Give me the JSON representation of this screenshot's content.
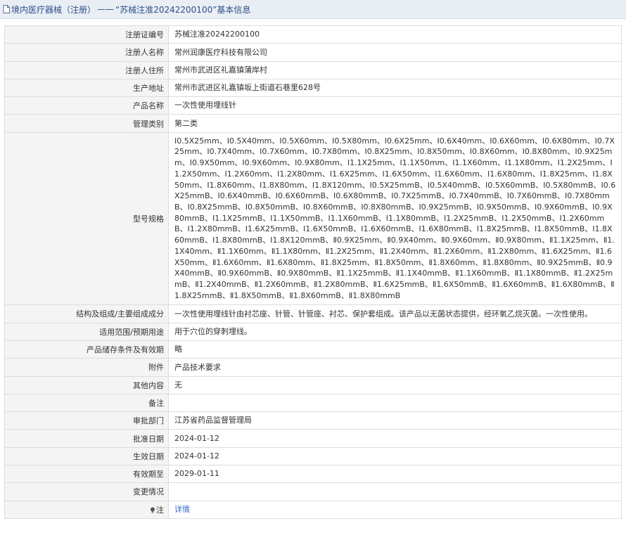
{
  "header": {
    "prefix": "境内医疗器械（注册）",
    "separator": "——",
    "title": "“苏械注准20242200100”基本信息"
  },
  "rows": [
    {
      "label": "注册证编号",
      "value": "苏械注准20242200100"
    },
    {
      "label": "注册人名称",
      "value": "常州润康医疗科技有限公司"
    },
    {
      "label": "注册人住所",
      "value": "常州市武进区礼嘉镇蒲岸村"
    },
    {
      "label": "生产地址",
      "value": "常州市武进区礼嘉镇坂上街道石巷里628号"
    },
    {
      "label": "产品名称",
      "value": "一次性使用埋线针"
    },
    {
      "label": "管理类别",
      "value": "第二类"
    },
    {
      "label": "型号规格",
      "value": "Ⅰ0.5X25mm、Ⅰ0.5X40mm、Ⅰ0.5X60mm、Ⅰ0.5X80mm、Ⅰ0.6X25mm、Ⅰ0.6X40mm、Ⅰ0.6X60mm、Ⅰ0.6X80mm、Ⅰ0.7X25mm、Ⅰ0.7X40mm、Ⅰ0.7X60mm、Ⅰ0.7X80mm、Ⅰ0.8X25mm、Ⅰ0.8X50mm、Ⅰ0.8X60mm、Ⅰ0.8X80mm、Ⅰ0.9X25mm、Ⅰ0.9X50mm、Ⅰ0.9X60mm、Ⅰ0.9X80mm、Ⅰ1.1X25mm、Ⅰ1.1X50mm、Ⅰ1.1X60mm、Ⅰ1.1X80mm、Ⅰ1.2X25mm、Ⅰ1.2X50mm、Ⅰ1.2X60mm、Ⅰ1.2X80mm、Ⅰ1.6X25mm、Ⅰ1.6X50mm、Ⅰ1.6X60mm、Ⅰ1.6X80mm、Ⅰ1.8X25mm、Ⅰ1.8X50mm、Ⅰ1.8X60mm、Ⅰ1.8X80mm、Ⅰ1.8X120mm、Ⅰ0.5X25mmB、Ⅰ0.5X40mmB、Ⅰ0.5X60mmB、Ⅰ0.5X80mmB、Ⅰ0.6X25mmB、Ⅰ0.6X40mmB、Ⅰ0.6X60mmB、Ⅰ0.6X80mmB、Ⅰ0.7X25mmB、Ⅰ0.7X40mmB、Ⅰ0.7X60mmB、Ⅰ0.7X80mmB、Ⅰ0.8X25mmB、Ⅰ0.8X50mmB、Ⅰ0.8X60mmB、Ⅰ0.8X80mmB、Ⅰ0.9X25mmB、Ⅰ0.9X50mmB、Ⅰ0.9X60mmB、Ⅰ0.9X80mmB、Ⅰ1.1X25mmB、Ⅰ1.1X50mmB、Ⅰ1.1X60mmB、Ⅰ1.1X80mmB、Ⅰ1.2X25mmB、Ⅰ1.2X50mmB、Ⅰ1.2X60mmB、Ⅰ1.2X80mmB、Ⅰ1.6X25mmB、Ⅰ1.6X50mmB、Ⅰ1.6X60mmB、Ⅰ1.6X80mmB、Ⅰ1.8X25mmB、Ⅰ1.8X50mmB、Ⅰ1.8X60mmB、Ⅰ1.8X80mmB、Ⅰ1.8X120mmB、Ⅱ0.9X25mm、Ⅱ0.9X40mm、Ⅱ0.9X60mm、Ⅱ0.9X80mm、Ⅱ1.1X25mm、Ⅱ1.1X40mm、Ⅱ1.1X60mm、Ⅱ1.1X80mm、Ⅱ1.2X25mm、Ⅱ1.2X40mm、Ⅱ1.2X60mm、Ⅱ1.2X80mm、Ⅱ1.6X25mm、Ⅱ1.6X50mm、Ⅱ1.6X60mm、Ⅱ1.6X80mm、Ⅱ1.8X25mm、Ⅱ1.8X50mm、Ⅱ1.8X60mm、Ⅱ1.8X80mm、Ⅱ0.9X25mmB、Ⅱ0.9X40mmB、Ⅱ0.9X60mmB、Ⅱ0.9X80mmB、Ⅱ1.1X25mmB、Ⅱ1.1X40mmB、Ⅱ1.1X60mmB、Ⅱ1.1X80mmB、Ⅱ1.2X25mmB、Ⅱ1.2X40mmB、Ⅱ1.2X60mmB、Ⅱ1.2X80mmB、Ⅱ1.6X25mmB、Ⅱ1.6X50mmB、Ⅱ1.6X60mmB、Ⅱ1.6X80mmB、Ⅱ1.8X25mmB、Ⅱ1.8X50mmB、Ⅱ1.8X60mmB、Ⅱ1.8X80mmB"
    },
    {
      "label": "结构及组成/主要组成成分",
      "value": "一次性使用埋线针由衬芯座、针管、针管座、衬芯、保护套组成。该产品以无菌状态提供，经环氧乙烷灭菌。一次性使用。"
    },
    {
      "label": "适用范围/预期用途",
      "value": "用于穴位的穿刺埋线。"
    },
    {
      "label": "产品储存条件及有效期",
      "value": "略"
    },
    {
      "label": "附件",
      "value": "产品技术要求"
    },
    {
      "label": "其他内容",
      "value": "无"
    },
    {
      "label": "备注",
      "value": ""
    },
    {
      "label": "审批部门",
      "value": "江苏省药品监督管理局"
    },
    {
      "label": "批准日期",
      "value": "2024-01-12"
    },
    {
      "label": "生效日期",
      "value": "2024-01-12"
    },
    {
      "label": "有效期至",
      "value": "2029-01-11"
    },
    {
      "label": "变更情况",
      "value": ""
    }
  ],
  "note": {
    "label": "注",
    "link": "详情"
  },
  "colors": {
    "header_bg": "#e9eef5",
    "header_text": "#2e4e86",
    "label_bg": "#f4f4f4",
    "link": "#3366cc"
  }
}
